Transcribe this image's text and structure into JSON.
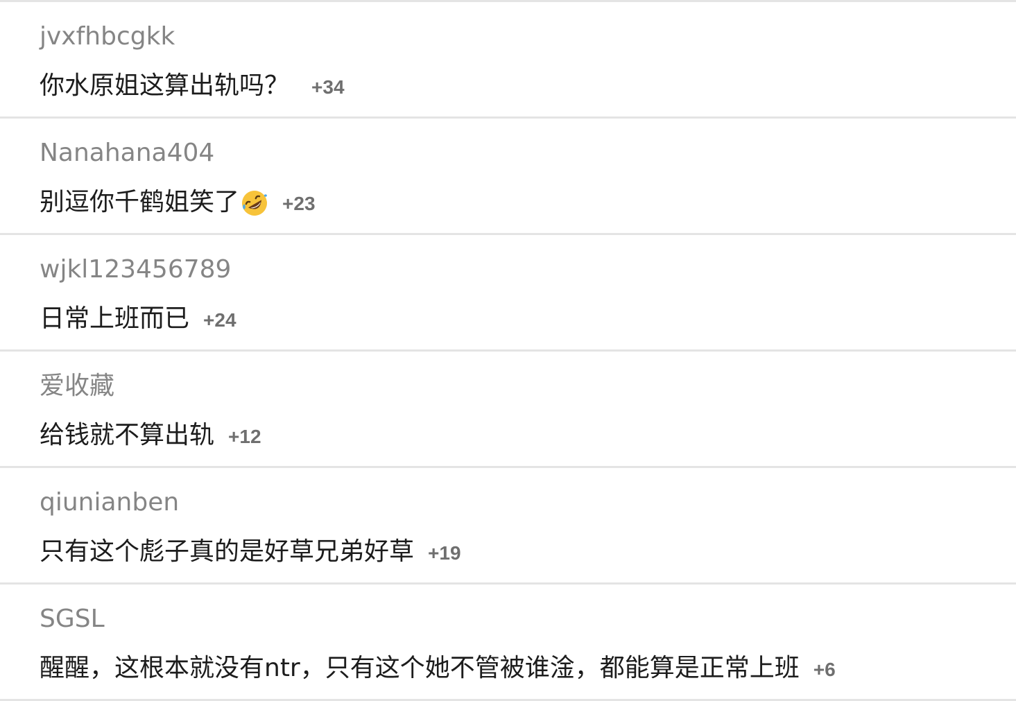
{
  "comments": [
    {
      "username": "jvxfhbcgkk",
      "text": "你水原姐这算出轨吗？",
      "emoji": "",
      "score": "+34"
    },
    {
      "username": "Nanahana404",
      "text": "别逗你千鹤姐笑了",
      "emoji": "rolling-on-floor-laughing-icon",
      "score": "+23"
    },
    {
      "username": "wjkl123456789",
      "text": "日常上班而已",
      "emoji": "",
      "score": "+24"
    },
    {
      "username": "爱收藏",
      "text": "给钱就不算出轨",
      "emoji": "",
      "score": "+12"
    },
    {
      "username": "qiunianben",
      "text": "只有这个彪子真的是好草兄弟好草",
      "emoji": "",
      "score": "+19"
    },
    {
      "username": "SGSL",
      "text": "醒醒，这根本就没有ntr，只有这个她不管被谁淦，都能算是正常上班",
      "emoji": "",
      "score": "+6"
    }
  ],
  "colors": {
    "username": "#858585",
    "text": "#1c1c1c",
    "score": "#6f6f6f",
    "divider": "#e4e4e4",
    "emoji_face": "#f7c33a"
  }
}
